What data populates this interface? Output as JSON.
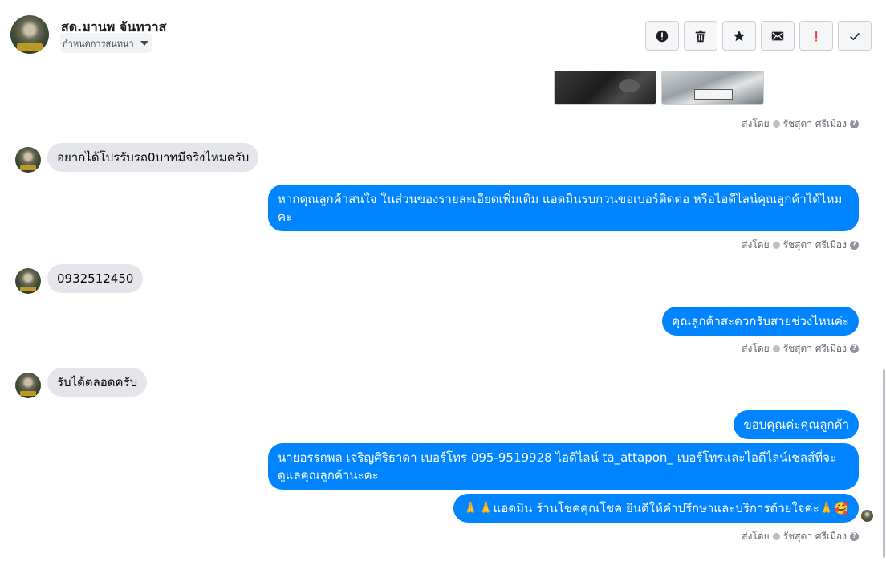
{
  "header": {
    "contact_name": "สด.มานพ จันทวาส",
    "assign_label": "กำหนดการสนทนา",
    "actions": [
      {
        "name": "spam-button",
        "icon": "alert-circle-icon"
      },
      {
        "name": "delete-button",
        "icon": "trash-icon"
      },
      {
        "name": "star-button",
        "icon": "star-icon"
      },
      {
        "name": "mark-unread-button",
        "icon": "envelope-icon"
      },
      {
        "name": "follow-up-button",
        "icon": "exclamation-icon"
      },
      {
        "name": "mark-done-button",
        "icon": "checkmark-icon"
      }
    ]
  },
  "chat": {
    "sent_by_prefix": "ส่งโดย",
    "sent_by_name": "รัชสุดา ศรีเมือง",
    "messages": [
      {
        "from": "customer",
        "text": "อยากได้โปรรับรถ0บาทมีจริงไหมครับ"
      },
      {
        "from": "page",
        "text": "หากคุณลูกค้าสนใจ ในส่วนของรายละเอียดเพิ่มเติม แอดมินรบกวนขอเบอร์ติดต่อ หรือไอดีไลน์คุณลูกค้าได้ไหมคะ"
      },
      {
        "from": "customer",
        "text": "0932512450"
      },
      {
        "from": "page",
        "text": "คุณลูกค้าสะดวกรับสายช่วงไหนค่ะ"
      },
      {
        "from": "customer",
        "text": "รับได้ตลอดครับ"
      },
      {
        "from": "page",
        "text": "ขอบคุณค่ะคุณลูกค้า"
      },
      {
        "from": "page",
        "text": "นายอรรถพล เจริญศิริธาดา      เบอร์โทร 095-9519928 ไอดีไลน์ ta_attapon_   เบอร์โทรและไอดีไลน์เซลส์ที่จะดูแลคุณลูกค้านะคะ"
      },
      {
        "from": "page",
        "text": "🙏🙏แอดมิน ร้านโชคคุณโชค ยินดีให้คำปรึกษาและบริการด้วยใจค่ะ🙏🥰"
      }
    ]
  },
  "colors": {
    "outgoing_bubble": "#0084ff",
    "incoming_bubble": "#e4e6eb"
  }
}
